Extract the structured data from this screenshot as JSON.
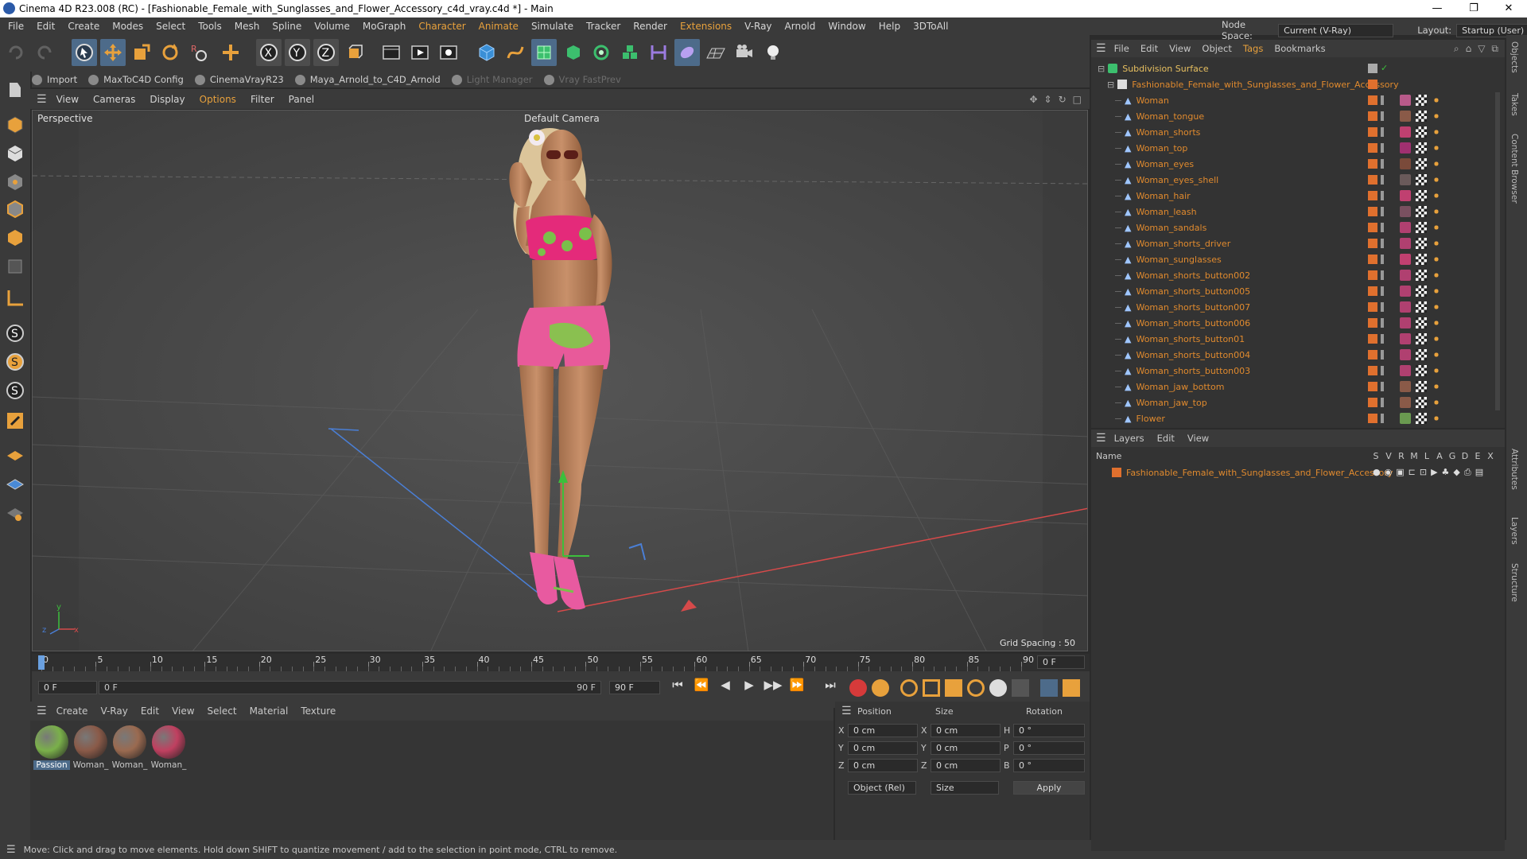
{
  "titlebar": {
    "title": "Cinema 4D R23.008 (RC) - [Fashionable_Female_with_Sunglasses_and_Flower_Accessory_c4d_vray.c4d *] - Main",
    "min": "—",
    "restore": "❐",
    "close": "✕"
  },
  "menubar": {
    "items": [
      "File",
      "Edit",
      "Create",
      "Modes",
      "Select",
      "Tools",
      "Mesh",
      "Spline",
      "Volume",
      "MoGraph",
      "Character",
      "Animate",
      "Simulate",
      "Tracker",
      "Render",
      "Extensions",
      "V-Ray",
      "Arnold",
      "Window",
      "Help",
      "3DToAll"
    ],
    "node_space_label": "Node Space:",
    "node_space_value": "Current (V-Ray)",
    "layout_label": "Layout:",
    "layout_value": "Startup (User)"
  },
  "plugins": {
    "items": [
      "Import",
      "MaxToC4D Config",
      "CinemaVrayR23",
      "Maya_Arnold_to_C4D_Arnold",
      "Light Manager",
      "Vray FastPrev"
    ]
  },
  "viewport": {
    "menu": [
      "View",
      "Cameras",
      "Display",
      "Options",
      "Filter",
      "Panel"
    ],
    "label": "Perspective",
    "camera": "Default Camera",
    "grid_spacing": "Grid Spacing : 50 cm"
  },
  "timeline": {
    "ticks": [
      "0",
      "5",
      "10",
      "15",
      "20",
      "25",
      "30",
      "35",
      "40",
      "45",
      "50",
      "55",
      "60",
      "65",
      "70",
      "75",
      "80",
      "85",
      "90"
    ],
    "frame_right": "0 F",
    "start": "0 F",
    "cur": "0 F",
    "end1": "90 F",
    "end2": "90 F"
  },
  "materials": {
    "menu": [
      "Create",
      "V-Ray",
      "Edit",
      "View",
      "Select",
      "Material",
      "Texture"
    ],
    "items": [
      {
        "label": "Passion",
        "color": "#7ab04a"
      },
      {
        "label": "Woman_",
        "color": "#8a5a48"
      },
      {
        "label": "Woman_",
        "color": "#9a6a50"
      },
      {
        "label": "Woman_",
        "color": "#c04060"
      }
    ]
  },
  "coords": {
    "headers": [
      "Position",
      "Size",
      "Rotation"
    ],
    "rows": [
      {
        "a": "X",
        "pv": "0 cm",
        "b": "X",
        "sv": "0 cm",
        "c": "H",
        "rv": "0 °"
      },
      {
        "a": "Y",
        "pv": "0 cm",
        "b": "Y",
        "sv": "0 cm",
        "c": "P",
        "rv": "0 °"
      },
      {
        "a": "Z",
        "pv": "0 cm",
        "b": "Z",
        "sv": "0 cm",
        "c": "B",
        "rv": "0 °"
      }
    ],
    "mode": "Object (Rel)",
    "size_mode": "Size",
    "apply": "Apply"
  },
  "status": {
    "text": "Move: Click and drag to move elements. Hold down SHIFT to quantize movement / add to the selection in point mode, CTRL to remove."
  },
  "objmgr": {
    "menu": [
      "File",
      "Edit",
      "View",
      "Object",
      "Tags",
      "Bookmarks"
    ],
    "root": "Subdivision Surface",
    "group": "Fashionable_Female_with_Sunglasses_and_Flower_Accessory",
    "objects": [
      "Woman",
      "Woman_tongue",
      "Woman_shorts",
      "Woman_top",
      "Woman_eyes",
      "Woman_eyes_shell",
      "Woman_hair",
      "Woman_leash",
      "Woman_sandals",
      "Woman_shorts_driver",
      "Woman_sunglasses",
      "Woman_shorts_button002",
      "Woman_shorts_button005",
      "Woman_shorts_button007",
      "Woman_shorts_button006",
      "Woman_shorts_button01",
      "Woman_shorts_button004",
      "Woman_shorts_button003",
      "Woman_jaw_bottom",
      "Woman_jaw_top",
      "Flower"
    ]
  },
  "layers": {
    "menu": [
      "Layers",
      "Edit",
      "View"
    ],
    "name_header": "Name",
    "cols": [
      "S",
      "V",
      "R",
      "M",
      "L",
      "A",
      "G",
      "D",
      "E",
      "X"
    ],
    "layer": "Fashionable_Female_with_Sunglasses_and_Flower_Accessory"
  },
  "righttabs": [
    "Objects",
    "Takes",
    "Content Browser",
    "Attributes",
    "Layers",
    "Structure"
  ],
  "colors": {
    "accent": "#e08a2e",
    "bg": "#3a3a3a"
  }
}
